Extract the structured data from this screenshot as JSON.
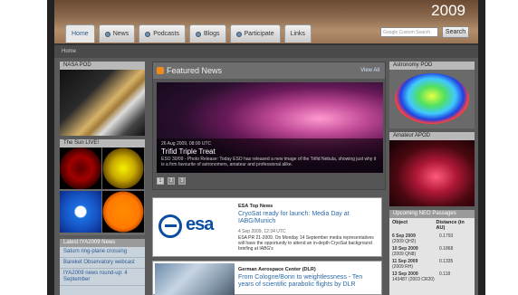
{
  "header": {
    "year": "2009",
    "tabs": [
      "Home",
      "News",
      "Podcasts",
      "Blogs",
      "Participate",
      "Links"
    ],
    "search_placeholder": "Google Custom Search",
    "search_button": "Search"
  },
  "breadcrumb": "Home",
  "left": {
    "pod_title": "NASA POD",
    "sun_title": "The Sun LIVE!",
    "latest_title": "Latest IYA2009 News",
    "latest_items": [
      "Saturn ring-plane crossing",
      "Bareket Observatory webcast",
      "IYA2009 news round-up: 4 September"
    ]
  },
  "featured": {
    "heading": "Featured News",
    "view_all": "View All",
    "date": "26 Aug 2009, 08:00 UTC",
    "title": "Trifid Triple Treat",
    "desc": "ESO 30/09 - Photo Release: Today ESO has released a new image of the Trifid Nebula, showing just why it is a firm favourite of astronomers, amateur and professional alike.",
    "pages": [
      "1",
      "2",
      "3"
    ]
  },
  "news": [
    {
      "source": "ESA Top News",
      "title": "CryoSat ready for launch: Media Day at IABG/Munich",
      "meta": "4 Sep 2009, 12:34 UTC",
      "desc": "ESA PR 21-2009. On Monday 14 September media representatives will have the opportunity to attend an in-depth CryoSat background briefing at IABG's",
      "logo": "esa"
    },
    {
      "source": "German Aerospace Center (DLR)",
      "title": "From Cologne/Bonn to weightlessness - Ten years of scientific parabolic flights by DLR"
    }
  ],
  "right": {
    "apod1_title": "Astronomy POD",
    "apod2_title": "Amateur APOD",
    "neo_title": "Upcoming NEO Passages",
    "neo_col1": "Object",
    "neo_col2": "Distance (in AU)",
    "neo_rows": [
      {
        "date": "6 Sep 2009",
        "object": "(2009 QH2)",
        "dist": "0.1793"
      },
      {
        "date": "10 Sep 2009",
        "object": "(2009 QN8)",
        "dist": "0.1868"
      },
      {
        "date": "11 Sep 2009",
        "object": "(2009 RH)",
        "dist": "0.1335"
      },
      {
        "date": "13 Sep 2009",
        "object": "143487 (2003 CR20)",
        "dist": "0.118"
      }
    ]
  }
}
